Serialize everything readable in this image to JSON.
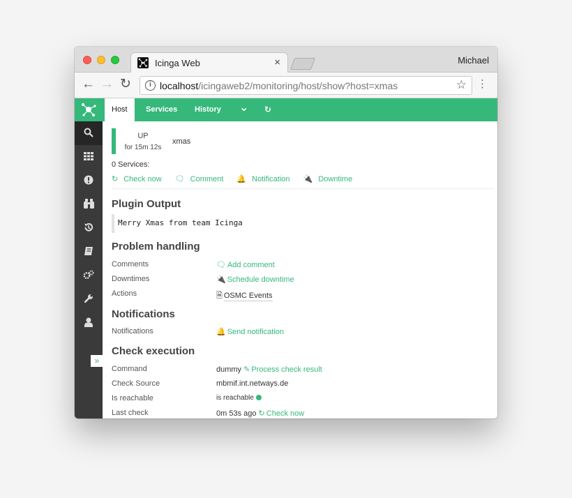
{
  "browser": {
    "tab_title": "Icinga Web",
    "tab_close": "×",
    "profile": "Michael",
    "url_host": "localhost",
    "url_path": "/icingaweb2/monitoring/host/show?host=xmas",
    "info": "i",
    "star": "☆",
    "menu": "⋮",
    "back": "←",
    "forward": "→",
    "reload": "↻"
  },
  "tabs": {
    "host": "Host",
    "services": "Services",
    "history": "History",
    "dropdown": "⌄",
    "refresh": "↻"
  },
  "sidebar": {
    "collapse": "»",
    "items": [
      "search-icon",
      "dashboard-icon",
      "problems-icon",
      "overview-icon",
      "history-icon",
      "documentation-icon",
      "system-icon",
      "configuration-icon",
      "user-icon"
    ]
  },
  "host": {
    "state": "UP",
    "duration": "for 15m 12s",
    "name": "xmas",
    "services_count": "0 Services:",
    "actions": {
      "check_now": "Check now",
      "comment": "Comment",
      "notification": "Notification",
      "downtime": "Downtime"
    }
  },
  "plugin_output": {
    "heading": "Plugin Output",
    "text": "Merry Xmas from team Icinga"
  },
  "problem_handling": {
    "heading": "Problem handling",
    "comments_label": "Comments",
    "comments_value": "Add comment",
    "downtimes_label": "Downtimes",
    "downtimes_value": "Schedule downtime",
    "actions_label": "Actions",
    "actions_value": "OSMC Events"
  },
  "notifications": {
    "heading": "Notifications",
    "label": "Notifications",
    "value": "Send notification"
  },
  "check_execution": {
    "heading": "Check execution",
    "command_label": "Command",
    "command_value": "dummy",
    "process_result": "Process check result",
    "source_label": "Check Source",
    "source_value": "mbmif.int.netways.de",
    "reachable_label": "Is reachable",
    "reachable_value": "is reachable",
    "last_check_label": "Last check",
    "last_check_value": "0m 53s ago",
    "last_check_action": "Check now"
  },
  "colors": {
    "accent": "#35b87a",
    "sidebar": "#3a3a3a"
  }
}
